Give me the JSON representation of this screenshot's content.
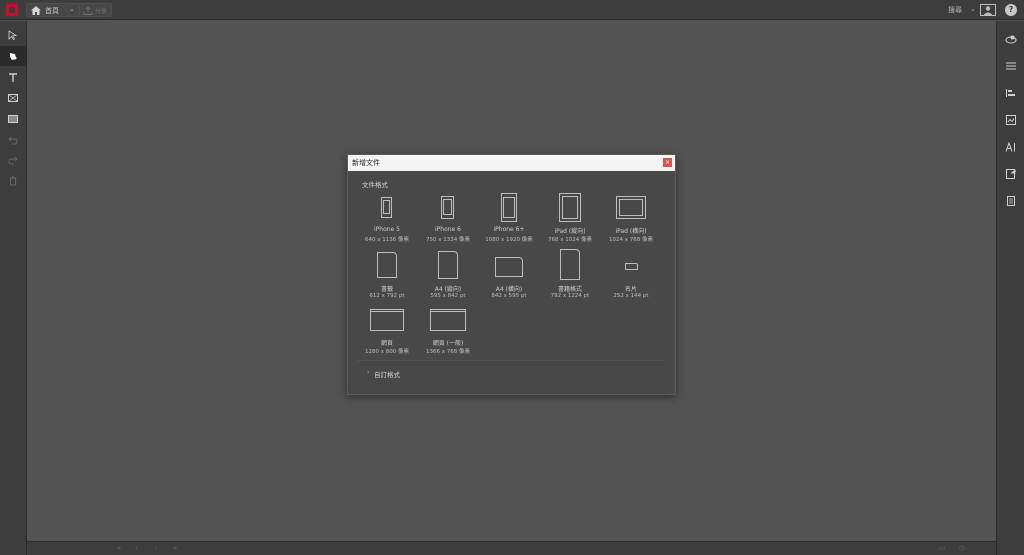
{
  "app": {
    "home_label": "首頁",
    "share_label": "分享"
  },
  "topbar": {
    "search_label": "搜尋"
  },
  "dialog": {
    "title": "新增文件",
    "section_title": "文件格式",
    "custom_label": "自訂格式",
    "presets": [
      {
        "name": "iPhone 5",
        "dims": "640 x 1136 像素"
      },
      {
        "name": "iPhone 6",
        "dims": "750 x 1334 像素"
      },
      {
        "name": "iPhone 6+",
        "dims": "1080 x 1920 像素"
      },
      {
        "name": "iPad (縱向)",
        "dims": "768 x 1024 像素"
      },
      {
        "name": "iPad (橫向)",
        "dims": "1024 x 768 像素"
      },
      {
        "name": "書籤",
        "dims": "612 x 792 pt"
      },
      {
        "name": "A4 (縱向)",
        "dims": "595 x 842 pt"
      },
      {
        "name": "A4 (橫向)",
        "dims": "842 x 595 pt"
      },
      {
        "name": "書籍格式",
        "dims": "792 x 1224 pt"
      },
      {
        "name": "名片",
        "dims": "252 x 144 pt"
      },
      {
        "name": "網頁",
        "dims": "1280 x 800 像素"
      },
      {
        "name": "網頁 (一般)",
        "dims": "1366 x 768 像素"
      }
    ]
  },
  "colors": {
    "canvas_bg": "#535353",
    "chrome_bg": "#3d3d3d",
    "dialog_bg": "#484848",
    "close_red": "#d9534f",
    "brand_red": "#c8102e"
  },
  "icons": {
    "left_toolbar": [
      "select-arrow-icon",
      "hand-tool-icon",
      "text-tool-icon",
      "image-frame-icon",
      "rectangle-tool-icon",
      "undo-icon",
      "redo-icon",
      "delete-icon"
    ],
    "right_panel": [
      "layers-3d-icon",
      "menu-lines-icon",
      "align-icon",
      "image-panel-icon",
      "type-panel-icon",
      "export-icon",
      "list-panel-icon"
    ]
  }
}
